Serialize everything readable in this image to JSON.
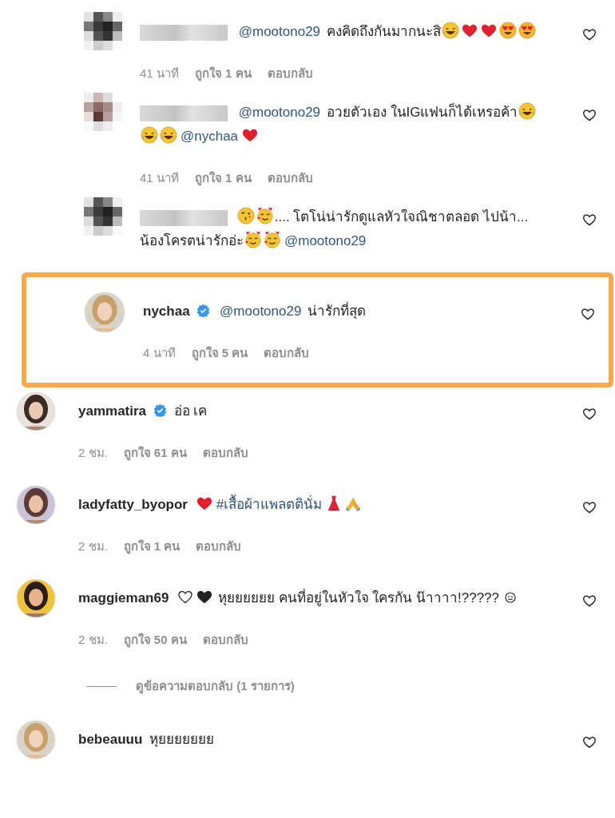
{
  "replies": [
    {
      "avatar": {
        "kind": "pixelated"
      },
      "username_hidden": true,
      "verified": false,
      "highlighted": false,
      "body": [
        {
          "kind": "mention",
          "text": "@mootono29"
        },
        {
          "kind": "text",
          "text": " คงคิดถึงกันมากนะสิ"
        },
        {
          "kind": "laugh-emoji"
        },
        {
          "kind": "heart-emoji"
        },
        {
          "kind": "heart-emoji"
        },
        {
          "kind": "heart-eyes-emoji"
        },
        {
          "kind": "heart-eyes-emoji"
        }
      ],
      "time": "41 นาที",
      "likes": "ถูกใจ 1 คน",
      "reply": "ตอบกลับ"
    },
    {
      "avatar": {
        "kind": "pixelated"
      },
      "username_hidden": true,
      "verified": false,
      "highlighted": false,
      "body": [
        {
          "kind": "mention",
          "text": "@mootono29"
        },
        {
          "kind": "text",
          "text": " อวยตัวเอง ในIGแฟนก็ได้เหรอค้า"
        },
        {
          "kind": "laugh-emoji"
        },
        {
          "kind": "laugh-emoji"
        },
        {
          "kind": "laugh-emoji"
        },
        {
          "kind": "mention",
          "text": "@nychaa"
        },
        {
          "kind": "heart-emoji"
        }
      ],
      "time": "41 นาที",
      "likes": "ถูกใจ 1 คน",
      "reply": "ตอบกลับ"
    },
    {
      "avatar": {
        "kind": "pixelated"
      },
      "username_hidden": true,
      "verified": false,
      "highlighted": false,
      "body": [
        {
          "kind": "kiss-emoji"
        },
        {
          "kind": "hearts-face-emoji"
        },
        {
          "kind": "text",
          "text": ".... โตโน่น่ารักดูแลหัวใจณิชาตลอด ไปน้า... น้องโครตน่ารักอ่ะ"
        },
        {
          "kind": "hearts-face-emoji"
        },
        {
          "kind": "hearts-face-emoji"
        },
        {
          "kind": "mention",
          "text": "@mootono29"
        }
      ]
    },
    {
      "avatar": {
        "kind": "picture"
      },
      "username": "nychaa",
      "verified": true,
      "highlighted": true,
      "body": [
        {
          "kind": "mention",
          "text": "@mootono29"
        },
        {
          "kind": "text",
          "text": " น่ารักที่สุด"
        }
      ],
      "time": "4 นาที",
      "likes": "ถูกใจ 5 คน",
      "reply": "ตอบกลับ"
    }
  ],
  "comments": [
    {
      "avatar": {
        "kind": "picture"
      },
      "username": "yammatira",
      "verified": true,
      "body": [
        {
          "kind": "text",
          "text": "อ่อ เค"
        }
      ],
      "time": "2 ชม.",
      "likes": "ถูกใจ 61 คน",
      "reply": "ตอบกลับ"
    },
    {
      "avatar": {
        "kind": "picture"
      },
      "username": "ladyfatty_byopor",
      "verified": false,
      "body": [
        {
          "kind": "heart-emoji"
        },
        {
          "kind": "hashtag",
          "text": "#เสื้อผ้าแพลตตินั่ม"
        },
        {
          "kind": "dress-emoji"
        },
        {
          "kind": "pray-emoji"
        }
      ],
      "time": "2 ชม.",
      "likes": "ถูกใจ 1 คน",
      "reply": "ตอบกลับ"
    },
    {
      "avatar": {
        "kind": "picture"
      },
      "username": "maggieman69",
      "verified": false,
      "body": [
        {
          "kind": "white-heart-emoji"
        },
        {
          "kind": "black-heart-emoji"
        },
        {
          "kind": "text",
          "text": " หุยยยยยย คนที่อยู่ในหัวใจ ใครกัน น๊าาาา!????? "
        },
        {
          "kind": "smile-emoji"
        }
      ],
      "time": "2 ชม.",
      "likes": "ถูกใจ 50 คน",
      "reply": "ตอบกลับ",
      "view_replies": "ดูข้อความตอบกลับ (1 รายการ)"
    },
    {
      "avatar": {
        "kind": "picture"
      },
      "username": "bebeauuu",
      "verified": false,
      "body": [
        {
          "kind": "text",
          "text": "หุยยยยยยย"
        }
      ]
    }
  ]
}
